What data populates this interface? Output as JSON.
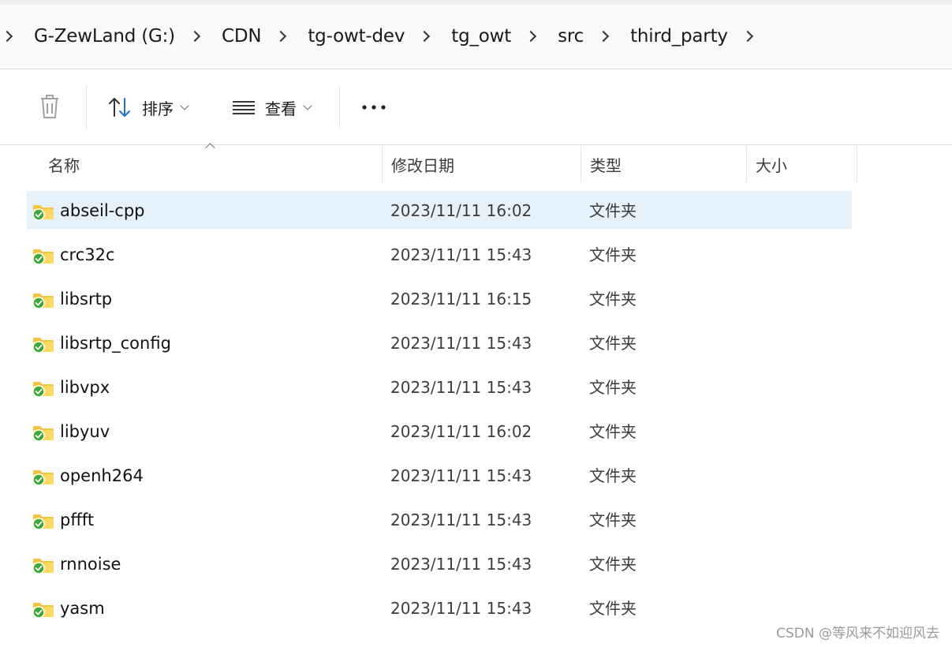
{
  "breadcrumb": {
    "items": [
      "G-ZewLand (G:)",
      "CDN",
      "tg-owt-dev",
      "tg_owt",
      "src",
      "third_party"
    ]
  },
  "toolbar": {
    "sort_label": "排序",
    "view_label": "查看"
  },
  "columns": {
    "name": "名称",
    "date": "修改日期",
    "type": "类型",
    "size": "大小"
  },
  "files": [
    {
      "name": "abseil-cpp",
      "date": "2023/11/11 16:02",
      "type": "文件夹",
      "selected": true
    },
    {
      "name": "crc32c",
      "date": "2023/11/11 15:43",
      "type": "文件夹"
    },
    {
      "name": "libsrtp",
      "date": "2023/11/11 16:15",
      "type": "文件夹"
    },
    {
      "name": "libsrtp_config",
      "date": "2023/11/11 15:43",
      "type": "文件夹"
    },
    {
      "name": "libvpx",
      "date": "2023/11/11 15:43",
      "type": "文件夹"
    },
    {
      "name": "libyuv",
      "date": "2023/11/11 16:02",
      "type": "文件夹"
    },
    {
      "name": "openh264",
      "date": "2023/11/11 15:43",
      "type": "文件夹"
    },
    {
      "name": "pffft",
      "date": "2023/11/11 15:43",
      "type": "文件夹"
    },
    {
      "name": "rnnoise",
      "date": "2023/11/11 15:43",
      "type": "文件夹"
    },
    {
      "name": "yasm",
      "date": "2023/11/11 15:43",
      "type": "文件夹"
    }
  ],
  "watermark": "CSDN @等风来不如迎风去",
  "colors": {
    "selected_row": "#e5f1fb",
    "folder_yellow": "#f5c542",
    "sync_green": "#3aa83a",
    "accent_blue": "#1a73c8"
  }
}
